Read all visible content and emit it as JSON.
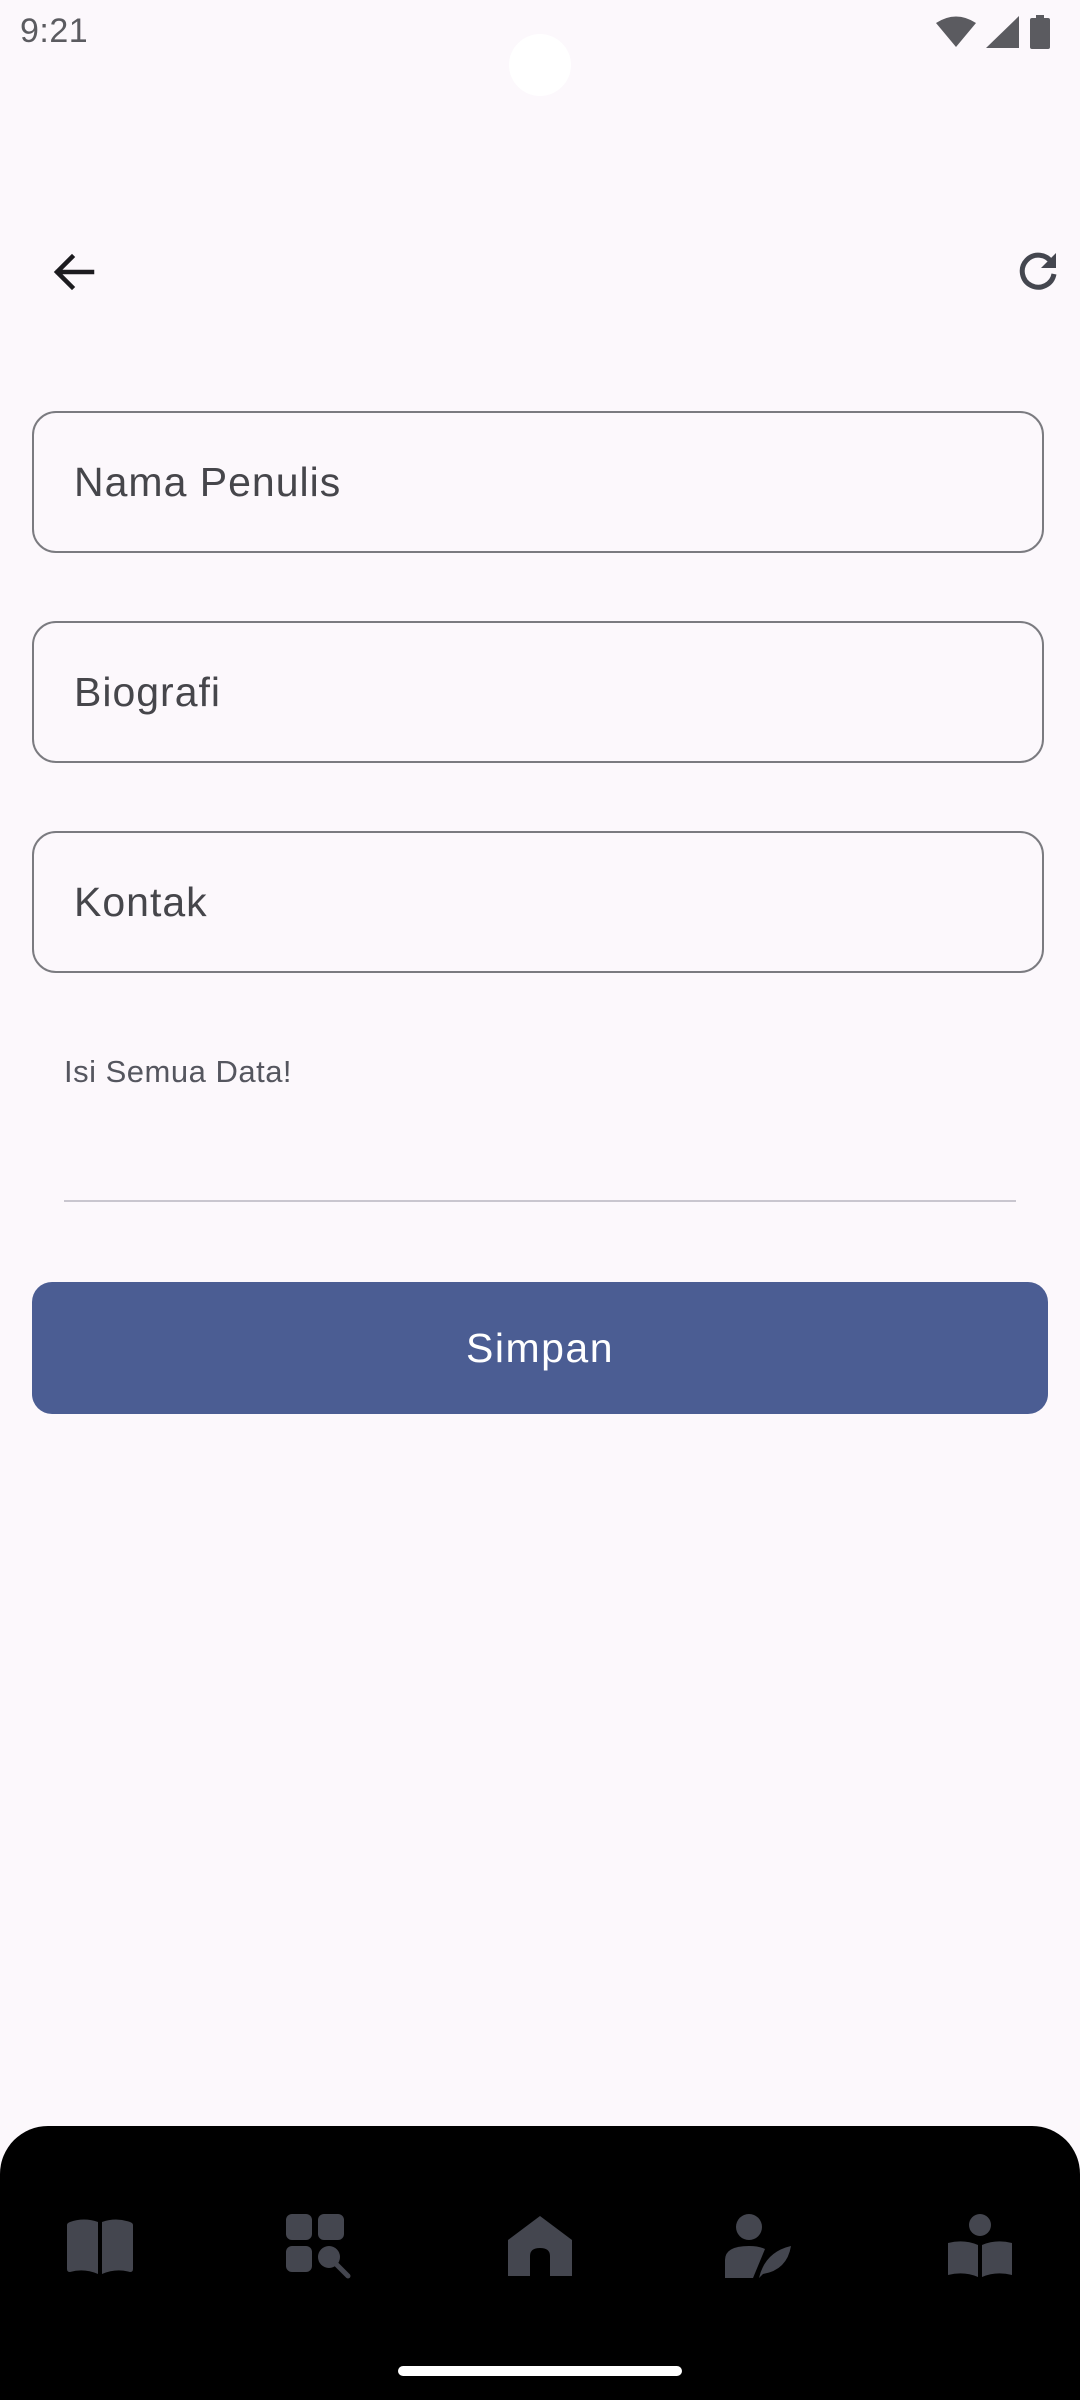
{
  "status_bar": {
    "time": "9:21",
    "icons": [
      "wifi-icon",
      "signal-icon",
      "battery-icon"
    ]
  },
  "app_bar": {
    "back_icon": "arrow-back-icon",
    "refresh_icon": "refresh-icon"
  },
  "form": {
    "name_placeholder": "Nama Penulis",
    "bio_placeholder": "Biografi",
    "contact_placeholder": "Kontak",
    "name_value": "",
    "bio_value": "",
    "contact_value": ""
  },
  "message": {
    "text": "Isi Semua Data!"
  },
  "actions": {
    "save_label": "Simpan"
  },
  "bottom_nav": {
    "items": [
      {
        "icon": "book-icon"
      },
      {
        "icon": "catalog-search-icon"
      },
      {
        "icon": "home-icon"
      },
      {
        "icon": "author-icon"
      },
      {
        "icon": "reader-icon"
      }
    ]
  },
  "colors": {
    "background": "#fcf8fc",
    "primary": "#4b5d93",
    "outline": "#7b7b80",
    "nav_background": "#000000",
    "nav_icon": "#44464f"
  }
}
